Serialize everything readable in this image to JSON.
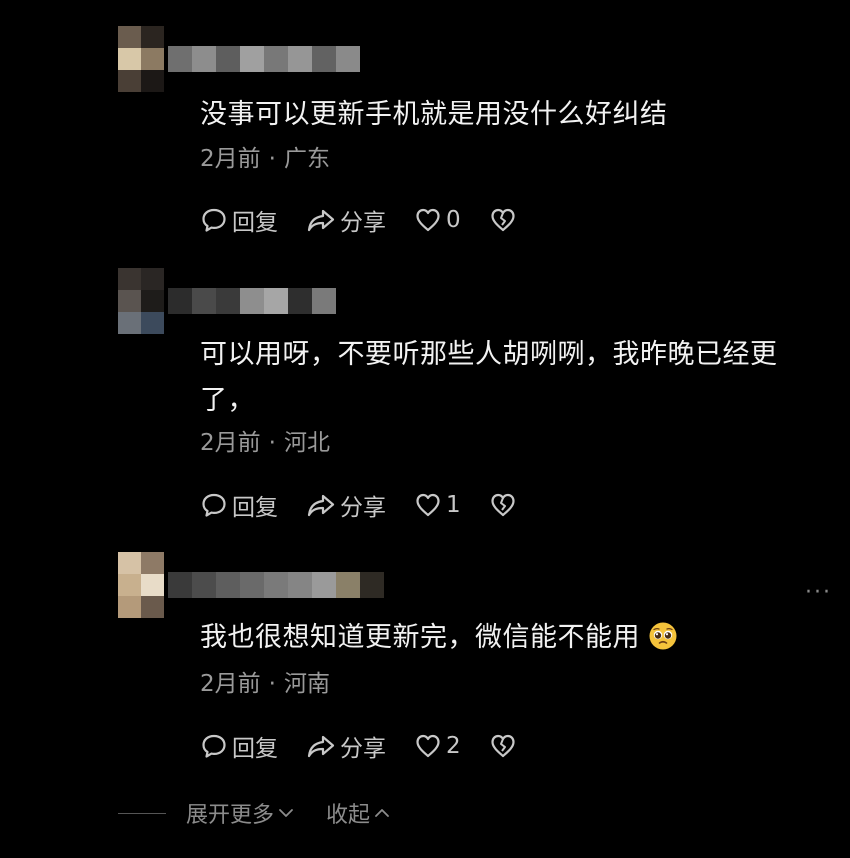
{
  "comments": [
    {
      "text": "没事可以更新手机就是用没什么好纠结",
      "time": "2月前",
      "location": "广东",
      "reply_label": "回复",
      "share_label": "分享",
      "like_count": "0"
    },
    {
      "text": "可以用呀，不要听那些人胡咧咧，我昨晚已经更了，",
      "time": "2月前",
      "location": "河北",
      "reply_label": "回复",
      "share_label": "分享",
      "like_count": "1"
    },
    {
      "text": "我也很想知道更新完，微信能不能用",
      "time": "2月前",
      "location": "河南",
      "reply_label": "回复",
      "share_label": "分享",
      "like_count": "2"
    }
  ],
  "separator": "·",
  "more_menu": "···",
  "footer": {
    "expand_label": "展开更多",
    "collapse_label": "收起"
  },
  "icons": [
    "comment-icon",
    "share-arrow-icon",
    "heart-icon",
    "broken-heart-icon",
    "pleading-face-emoji",
    "chevron-down-icon",
    "chevron-up-icon"
  ],
  "colors": {
    "background": "#000000",
    "text": "#f2f2f2",
    "meta": "#9a9a9a",
    "action": "#c8c8c8",
    "emoji": "#f5c33b"
  }
}
